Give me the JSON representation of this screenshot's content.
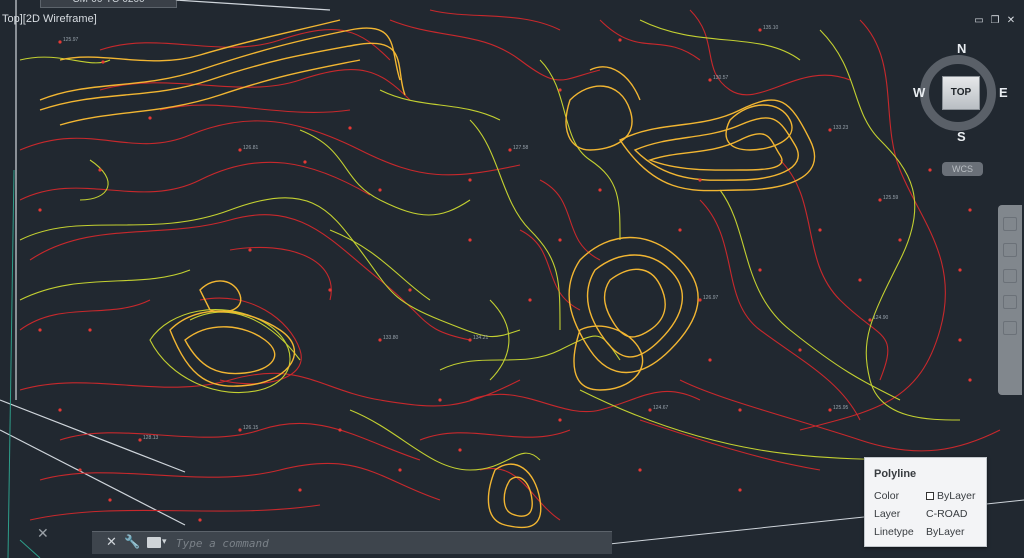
{
  "document_tab": {
    "title": "CM-00-TC-0200",
    "close_symbol": "×"
  },
  "viewport_label": "Top][2D Wireframe]",
  "window_controls": {
    "restore": "▭",
    "maximize": "❐",
    "close": "✕"
  },
  "viewcube": {
    "north": "N",
    "south": "S",
    "east": "E",
    "west": "W",
    "face": "TOP",
    "coord_system": "WCS"
  },
  "command_line": {
    "close_symbol": "✕",
    "customize_symbol": "🔧",
    "dropdown_symbol": "▾",
    "placeholder": "Type a command"
  },
  "quick_properties": {
    "title": "Polyline",
    "rows": [
      {
        "key": "Color",
        "value": "ByLayer"
      },
      {
        "key": "Layer",
        "value": "C-ROAD"
      },
      {
        "key": "Linetype",
        "value": "ByLayer"
      }
    ]
  },
  "colors": {
    "background": "#212830",
    "contour_minor": "#c8282c",
    "contour_mid": "#c3d031",
    "contour_major": "#f2b632",
    "spot_marker": "#e53935"
  },
  "spot_elevations": [
    "125.97",
    "126.81",
    "127.58",
    "130.57",
    "133.23",
    "135.10",
    "125.59",
    "126.97",
    "134.21",
    "133.80",
    "126.15",
    "128.13",
    "125.95",
    "124.67",
    "124.90"
  ]
}
